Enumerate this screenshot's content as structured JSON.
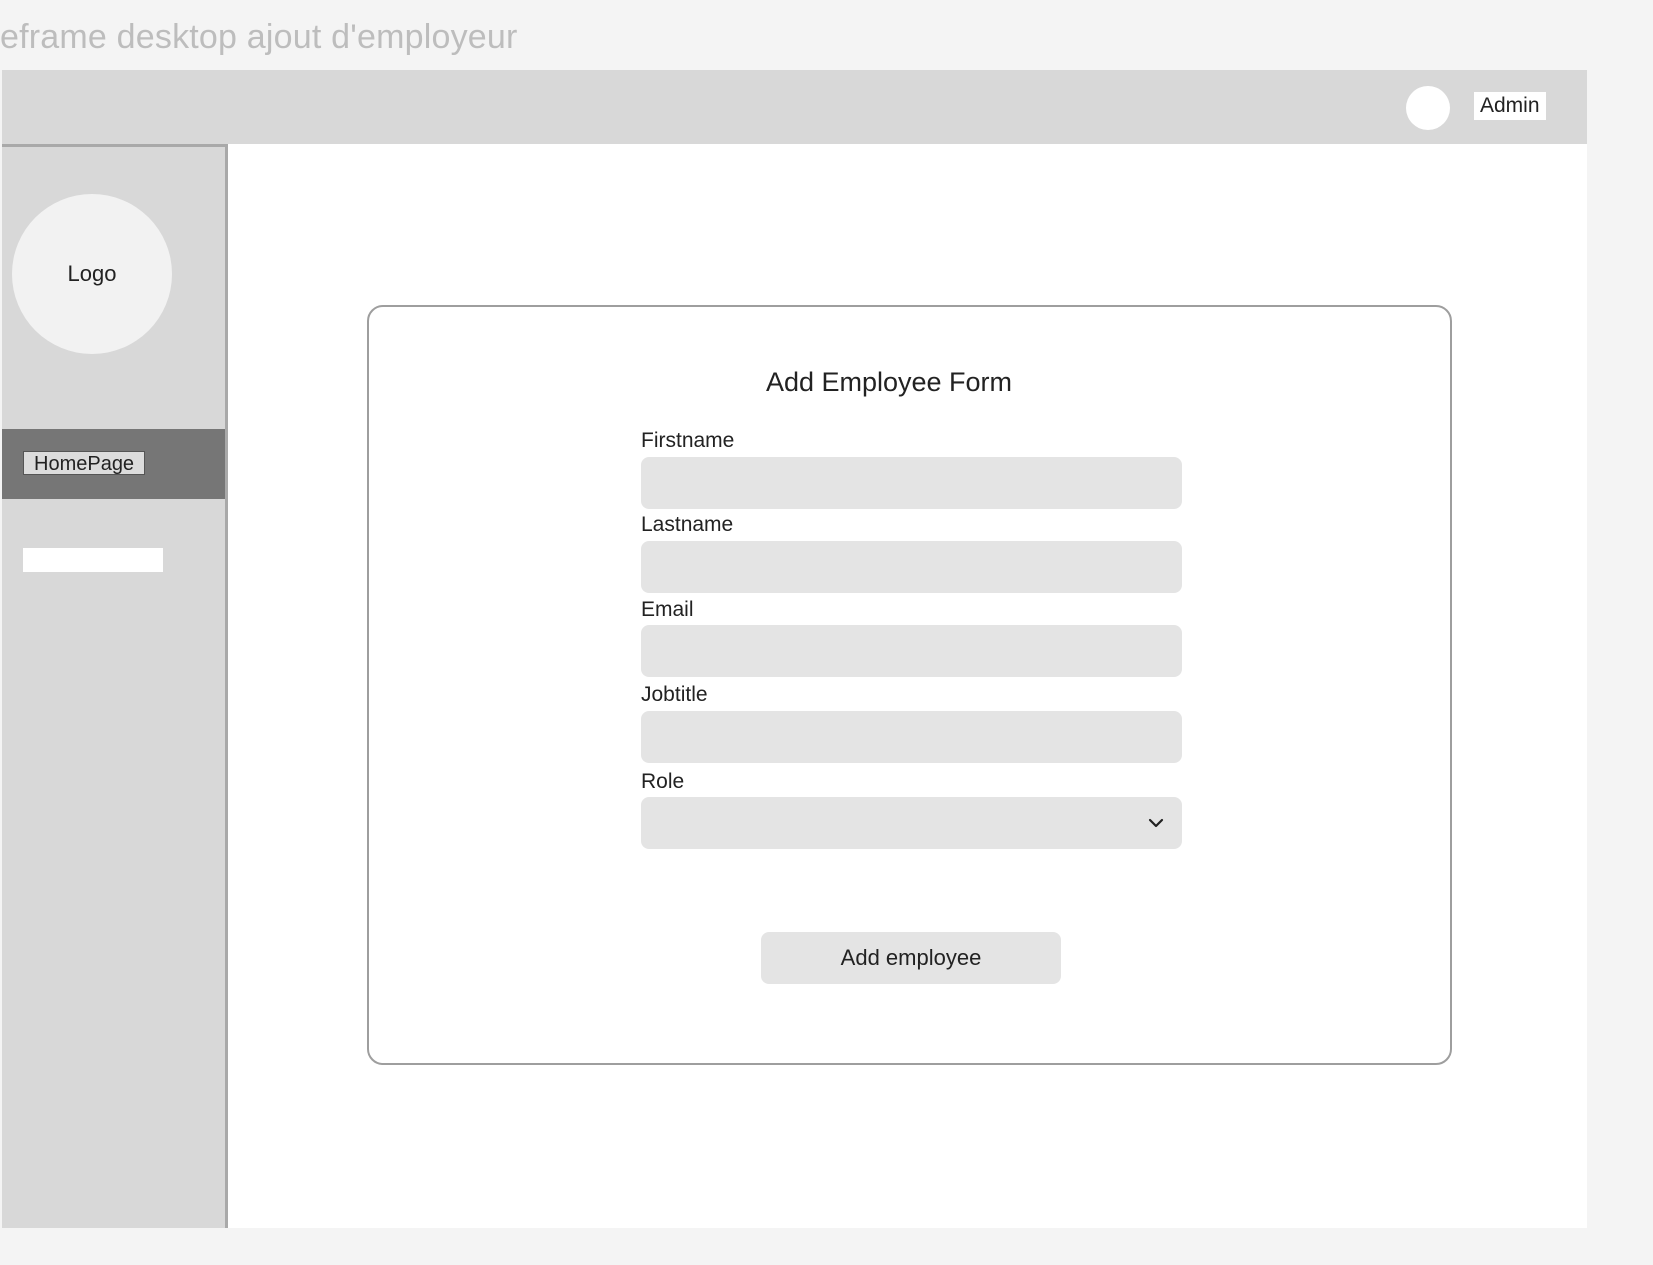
{
  "frame_title": "eframe desktop ajout d'employeur",
  "header": {
    "user_label": "Admin"
  },
  "sidebar": {
    "logo_label": "Logo",
    "items": [
      {
        "label": "HomePage"
      }
    ]
  },
  "form": {
    "title": "Add Employee Form",
    "fields": {
      "firstname": {
        "label": "Firstname",
        "value": ""
      },
      "lastname": {
        "label": "Lastname",
        "value": ""
      },
      "email": {
        "label": "Email",
        "value": ""
      },
      "jobtitle": {
        "label": "Jobtitle",
        "value": ""
      },
      "role": {
        "label": "Role",
        "value": ""
      }
    },
    "submit_label": "Add employee"
  },
  "colors": {
    "page_bg": "#f4f4f4",
    "bar_gray": "#d8d8d8",
    "active_nav": "#767676",
    "input_bg": "#e4e4e4"
  }
}
